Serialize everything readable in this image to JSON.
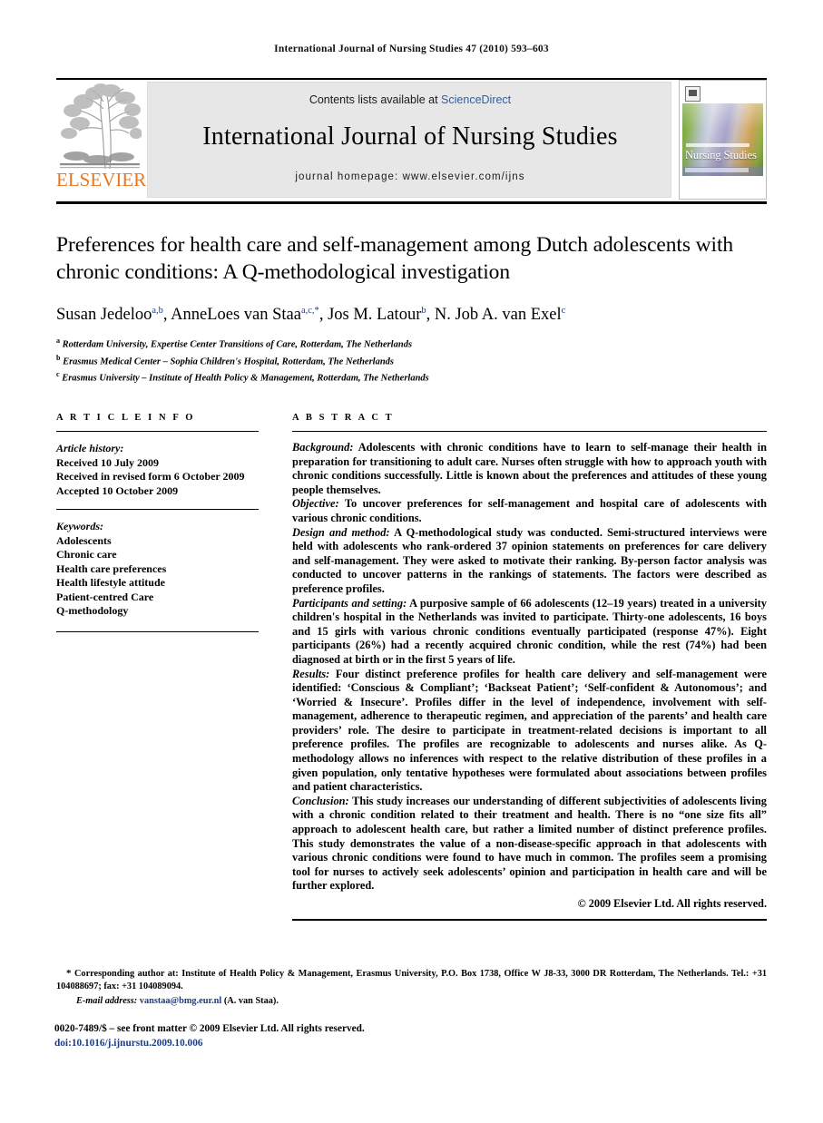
{
  "running_head": "International Journal of Nursing Studies 47 (2010) 593–603",
  "masthead": {
    "publisher_name": "ELSEVIER",
    "contents_prefix": "Contents lists available at ",
    "contents_link": "ScienceDirect",
    "journal_title": "International Journal of Nursing Studies",
    "homepage": "journal homepage: www.elsevier.com/ijns",
    "cover_title": "Nursing Studies"
  },
  "article": {
    "title": "Preferences for health care and self-management among Dutch adolescents with chronic conditions: A Q-methodological investigation",
    "authors": [
      {
        "name": "Susan Jedeloo",
        "sup": "a,b",
        "sep": ", "
      },
      {
        "name": "AnneLoes van Staa",
        "sup": "a,c,*",
        "sep": ", "
      },
      {
        "name": "Jos M. Latour",
        "sup": "b",
        "sep": ", "
      },
      {
        "name": "N. Job A. van Exel",
        "sup": "c",
        "sep": ""
      }
    ],
    "affiliations": [
      {
        "mark": "a",
        "text": "Rotterdam University, Expertise Center Transitions of Care, Rotterdam, The Netherlands"
      },
      {
        "mark": "b",
        "text": "Erasmus Medical Center – Sophia Children's Hospital, Rotterdam, The Netherlands"
      },
      {
        "mark": "c",
        "text": "Erasmus University – Institute of Health Policy & Management, Rotterdam, The Netherlands"
      }
    ]
  },
  "article_info": {
    "heading": "A R T I C L E  I N F O",
    "history_label": "Article history:",
    "history": [
      "Received 10 July 2009",
      "Received in revised form 6 October 2009",
      "Accepted 10 October 2009"
    ],
    "keywords_label": "Keywords:",
    "keywords": [
      "Adolescents",
      "Chronic care",
      "Health care preferences",
      "Health lifestyle attitude",
      "Patient-centred Care",
      "Q-methodology"
    ]
  },
  "abstract": {
    "heading": "A B S T R A C T",
    "sections": [
      {
        "label": "Background:",
        "text": " Adolescents with chronic conditions have to learn to self-manage their health in preparation for transitioning to adult care. Nurses often struggle with how to approach youth with chronic conditions successfully. Little is known about the preferences and attitudes of these young people themselves."
      },
      {
        "label": "Objective:",
        "text": " To uncover preferences for self-management and hospital care of adolescents with various chronic conditions."
      },
      {
        "label": "Design and method:",
        "text": " A Q-methodological study was conducted. Semi-structured interviews were held with adolescents who rank-ordered 37 opinion statements on preferences for care delivery and self-management. They were asked to motivate their ranking. By-person factor analysis was conducted to uncover patterns in the rankings of statements. The factors were described as preference profiles."
      },
      {
        "label": "Participants and setting:",
        "text": " A purposive sample of 66 adolescents (12–19 years) treated in a university children's hospital in the Netherlands was invited to participate. Thirty-one adolescents, 16 boys and 15 girls with various chronic conditions eventually participated (response 47%). Eight participants (26%) had a recently acquired chronic condition, while the rest (74%) had been diagnosed at birth or in the first 5 years of life."
      },
      {
        "label": "Results:",
        "text": " Four distinct preference profiles for health care delivery and self-management were identified: ‘Conscious & Compliant’; ‘Backseat Patient’; ‘Self-confident & Autonomous’; and ‘Worried & Insecure’. Profiles differ in the level of independence, involvement with self-management, adherence to therapeutic regimen, and appreciation of the parents’ and health care providers’ role. The desire to participate in treatment-related decisions is important to all preference profiles. The profiles are recognizable to adolescents and nurses alike. As Q-methodology allows no inferences with respect to the relative distribution of these profiles in a given population, only tentative hypotheses were formulated about associations between profiles and patient characteristics."
      },
      {
        "label": "Conclusion:",
        "text": " This study increases our understanding of different subjectivities of adolescents living with a chronic condition related to their treatment and health. There is no “one size fits all” approach to adolescent health care, but rather a limited number of distinct preference profiles. This study demonstrates the value of a non-disease-specific approach in that adolescents with various chronic conditions were found to have much in common. The profiles seem a promising tool for nurses to actively seek adolescents’ opinion and participation in health care and will be further explored."
      }
    ],
    "copyright": "© 2009 Elsevier Ltd. All rights reserved."
  },
  "footnotes": {
    "corresponding": "Corresponding author at: Institute of Health Policy & Management, Erasmus University, P.O. Box 1738, Office W J8-33, 3000 DR Rotterdam, The Netherlands. Tel.: +31 104088697; fax: +31 104089094.",
    "email_label": "E-mail address:",
    "email_address": "vanstaa@bmg.eur.nl",
    "email_owner": "(A. van Staa)."
  },
  "footer": {
    "issn_line": "0020-7489/$ – see front matter © 2009 Elsevier Ltd. All rights reserved.",
    "doi_line": "doi:10.1016/j.ijnurstu.2009.10.006"
  },
  "colors": {
    "elsevier_orange": "#E87722",
    "link_blue": "#1c3d86",
    "sciencedirect_blue": "#2b5fa8",
    "band_gray": "#e7e7e7"
  }
}
